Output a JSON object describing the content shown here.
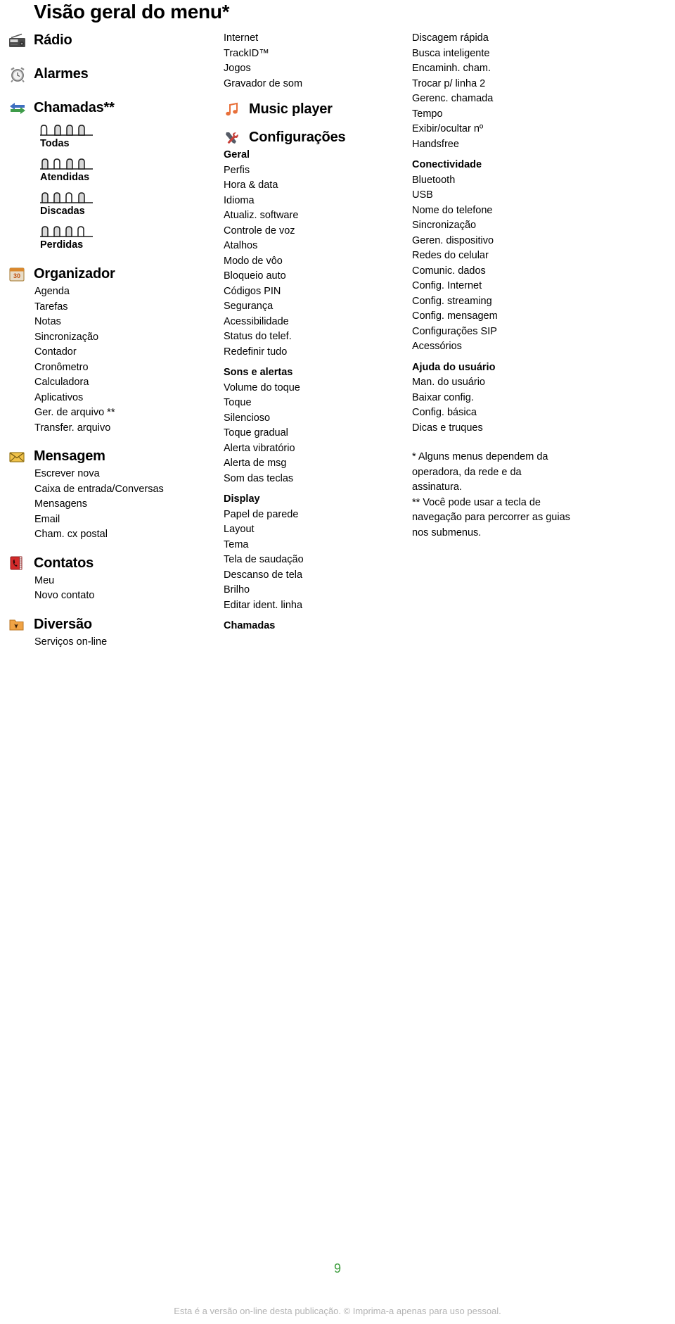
{
  "page": {
    "title": "Visão geral do menu*",
    "number": "9",
    "legal": "Esta é a versão on-line desta publicação. © Imprima-a apenas para uso pessoal."
  },
  "colors": {
    "page_number": "#3b9c3b",
    "legal": "#b3b3b3",
    "radio_icon": "#4d4d4d",
    "alarm_icon": "#9a9a9a",
    "calls_icon_blue": "#3f6fc0",
    "calls_icon_green": "#3f9c4a",
    "organizer_icon": "#e08a3c",
    "message_icon": "#e8b435",
    "contacts_icon": "#d32a2a",
    "fun_icon": "#f0a345",
    "music_icon": "#e8703a",
    "settings_icon": "#c8413a"
  },
  "column1": {
    "groups": [
      {
        "icon": "radio-icon",
        "title": "Rádio",
        "items": []
      },
      {
        "icon": "alarm-clock-icon",
        "title": "Alarmes",
        "items": []
      },
      {
        "icon": "calls-arrows-icon",
        "title": "Chamadas**",
        "tabs": [
          {
            "label": "Todas",
            "active": 0
          },
          {
            "label": "Atendidas",
            "active": 1
          },
          {
            "label": "Discadas",
            "active": 2
          },
          {
            "label": "Perdidas",
            "active": 3
          }
        ],
        "items": []
      },
      {
        "icon": "calendar-icon",
        "title": "Organizador",
        "items": [
          "Agenda",
          "Tarefas",
          "Notas",
          "Sincronização",
          "Contador",
          "Cronômetro",
          "Calculadora",
          "Aplicativos",
          "Ger. de arquivo **",
          "Transfer. arquivo"
        ]
      },
      {
        "icon": "envelope-icon",
        "title": "Mensagem",
        "items": [
          "Escrever nova",
          "Caixa de entrada/Conversas",
          "Mensagens",
          "Email",
          "Cham. cx postal"
        ]
      },
      {
        "icon": "contacts-book-icon",
        "title": "Contatos",
        "items": [
          "Meu",
          "Novo contato"
        ]
      },
      {
        "icon": "folder-fun-icon",
        "title": "Diversão",
        "items": [
          "Serviços on-line"
        ]
      }
    ]
  },
  "column2": {
    "top_items": [
      "Internet",
      "TrackID™",
      "Jogos",
      "Gravador de som"
    ],
    "groups": [
      {
        "icon": "music-note-icon",
        "title": "Music player",
        "items": []
      },
      {
        "icon": "tools-icon",
        "title": "Configurações",
        "sections": [
          {
            "heading": "Geral",
            "items": [
              "Perfis",
              "Hora & data",
              "Idioma",
              "Atualiz. software",
              "Controle de voz",
              "Atalhos",
              "Modo de vôo",
              "Bloqueio auto",
              "Códigos PIN",
              "Segurança",
              "Acessibilidade",
              "Status do telef.",
              "Redefinir tudo"
            ]
          },
          {
            "heading": "Sons e alertas",
            "items": [
              "Volume do toque",
              "Toque",
              "Silencioso",
              "Toque gradual",
              "Alerta vibratório",
              "Alerta de msg",
              "Som das teclas"
            ]
          },
          {
            "heading": "Display",
            "items": [
              "Papel de parede",
              "Layout",
              "Tema",
              "Tela de saudação",
              "Descanso de tela",
              "Brilho",
              "Editar ident. linha"
            ]
          },
          {
            "heading": "Chamadas",
            "items": []
          }
        ]
      }
    ]
  },
  "column3": {
    "sections": [
      {
        "heading": "",
        "items": [
          "Discagem rápida",
          "Busca inteligente",
          "Encaminh. cham.",
          "Trocar p/ linha 2",
          "Gerenc. chamada",
          "Tempo",
          "Exibir/ocultar nº",
          "Handsfree"
        ]
      },
      {
        "heading": "Conectividade",
        "items": [
          "Bluetooth",
          "USB",
          "Nome do telefone",
          "Sincronização",
          "Geren. dispositivo",
          "Redes do celular",
          "Comunic. dados",
          "Config. Internet",
          "Config. streaming",
          "Config. mensagem",
          "Configurações SIP",
          "Acessórios"
        ]
      },
      {
        "heading": "Ajuda do usuário",
        "items": [
          "Man. do usuário",
          "Baixar config.",
          "Config. básica",
          "Dicas e truques"
        ]
      }
    ],
    "footnotes": [
      "* Alguns menus dependem da operadora, da rede e da assinatura.",
      "** Você pode usar a tecla de navegação para percorrer as guias nos submenus."
    ]
  }
}
